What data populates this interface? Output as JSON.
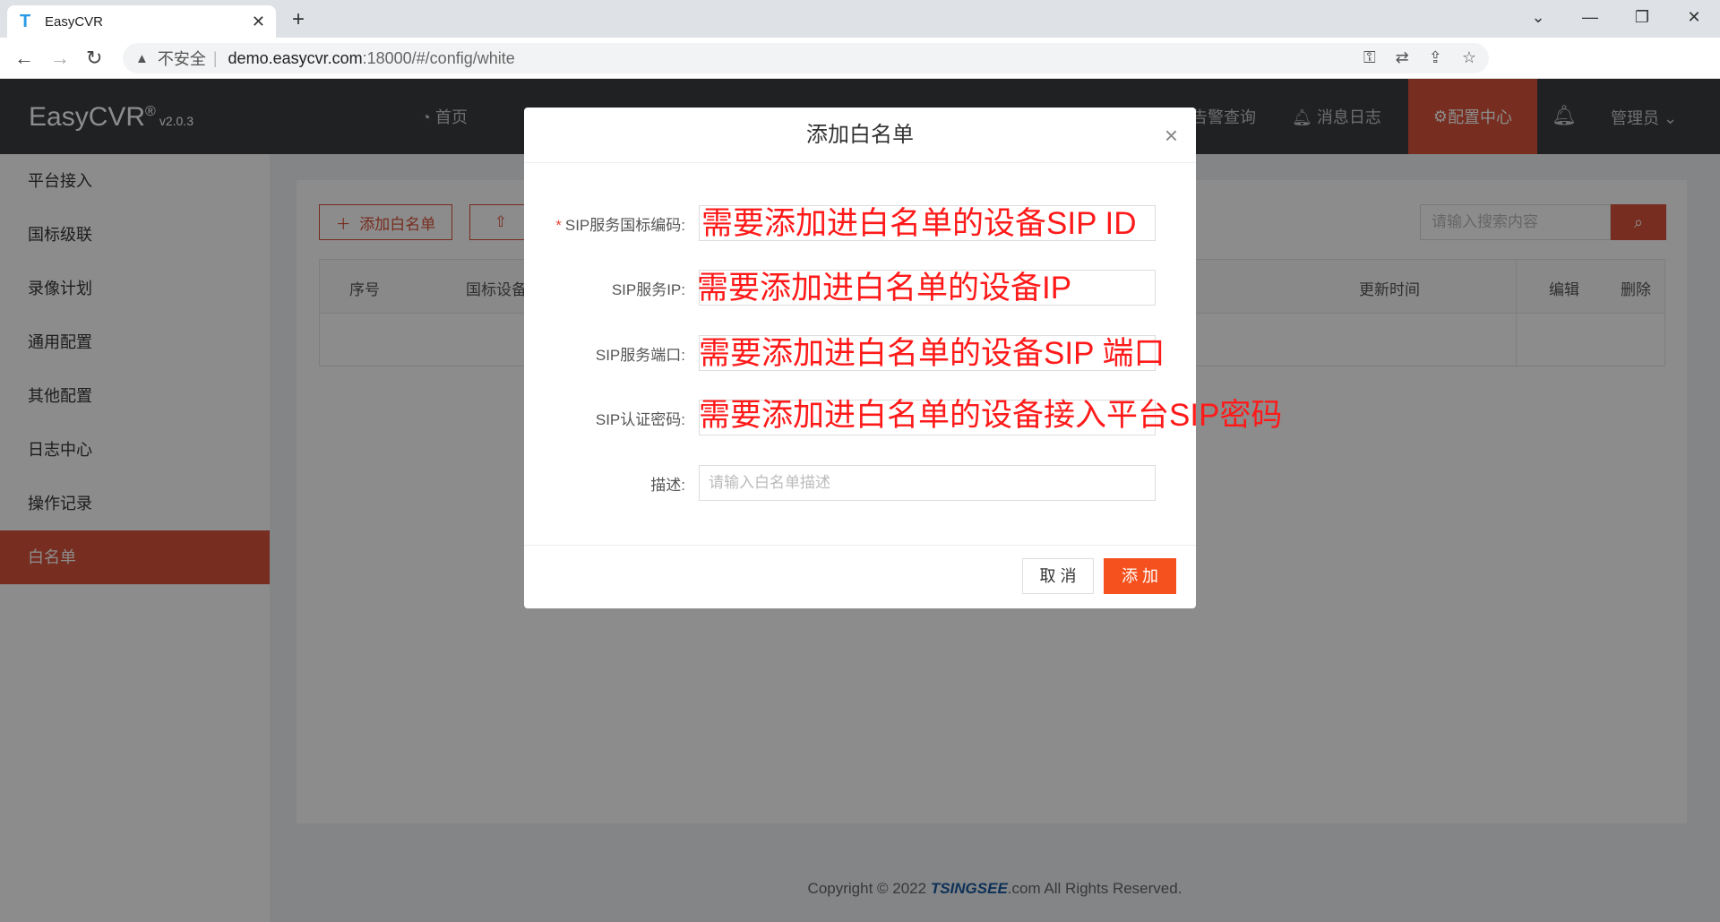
{
  "browser": {
    "tab_title": "EasyCVR",
    "insecure_label": "不安全",
    "url_host": "demo.easycvr.com",
    "url_rest": ":18000/#/config/white"
  },
  "app": {
    "logo": "EasyCVR",
    "version": "v2.0.3",
    "nav": {
      "home": "首页",
      "alarm_query": "告警查询",
      "message_log": "消息日志",
      "config_center": "配置中心",
      "admin": "管理员"
    },
    "sidebar": [
      {
        "label": "平台接入"
      },
      {
        "label": "国标级联"
      },
      {
        "label": "录像计划"
      },
      {
        "label": "通用配置"
      },
      {
        "label": "其他配置"
      },
      {
        "label": "日志中心"
      },
      {
        "label": "操作记录"
      },
      {
        "label": "白名单"
      }
    ],
    "toolbar": {
      "add_whitelist": "添加白名单",
      "search_placeholder": "请输入搜索内容"
    },
    "table": {
      "col_index": "序号",
      "col_gb": "国标设备",
      "col_update_time": "更新时间",
      "col_edit": "编辑",
      "col_delete": "删除"
    },
    "footer": {
      "prefix": "Copyright © 2022 ",
      "brand": "TSINGSEE",
      "suffix": ".com All Rights Reserved."
    }
  },
  "modal": {
    "title": "添加白名单",
    "fields": {
      "sip_id_label": "SIP服务国标编码:",
      "sip_ip_label": "SIP服务IP:",
      "sip_port_label": "SIP服务端口:",
      "sip_pwd_label": "SIP认证密码:",
      "desc_label": "描述:",
      "desc_placeholder": "请输入白名单描述"
    },
    "annotations": {
      "sip_id": "需要添加进白名单的设备SIP ID",
      "sip_ip": "需要添加进白名单的设备IP",
      "sip_port": "需要添加进白名单的设备SIP 端口",
      "sip_pwd": "需要添加进白名单的设备接入平台SIP密码"
    },
    "cancel_label": "取 消",
    "add_label": "添 加"
  }
}
